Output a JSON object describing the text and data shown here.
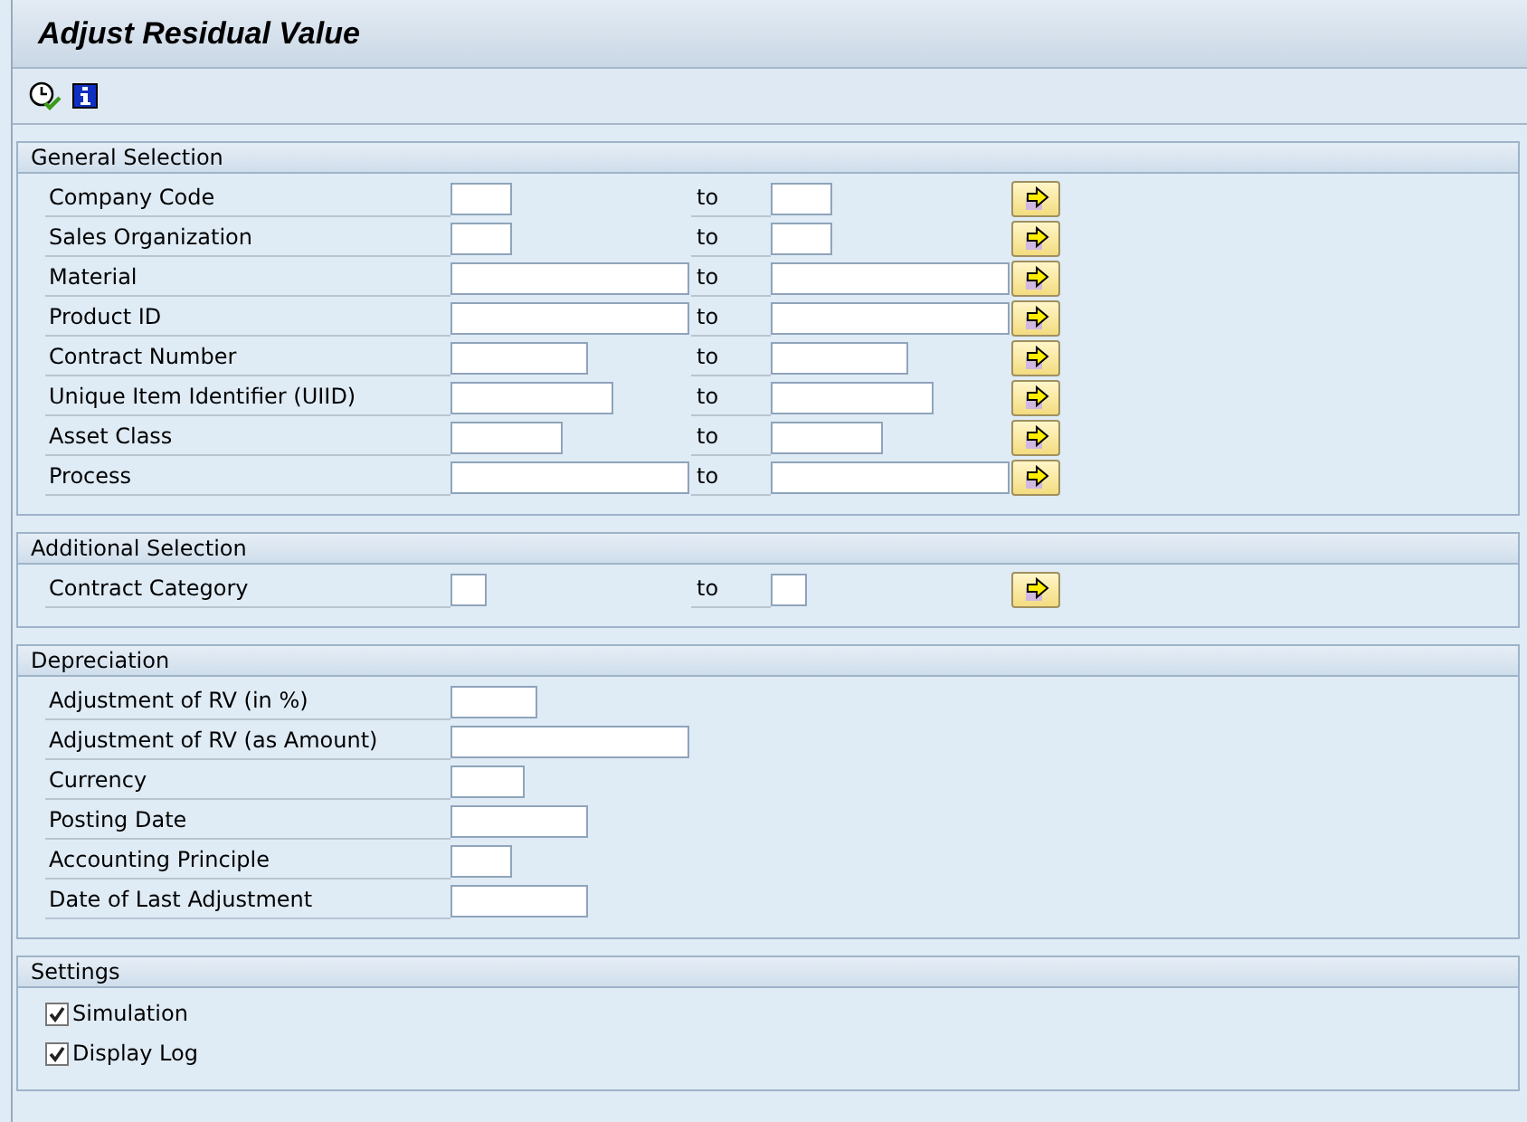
{
  "window": {
    "title": "Adjust Residual Value"
  },
  "toolbar": [
    {
      "kind": "execute-clock"
    },
    {
      "kind": "info"
    }
  ],
  "sections": [
    {
      "title": "General Selection",
      "rows": [
        {
          "kind": "range",
          "label": "Company Code",
          "to_label": "to"
        },
        {
          "kind": "range",
          "label": "Sales Organization",
          "to_label": "to"
        },
        {
          "kind": "range",
          "label": "Material",
          "to_label": "to"
        },
        {
          "kind": "range",
          "label": "Product ID",
          "to_label": "to"
        },
        {
          "kind": "range",
          "label": "Contract Number",
          "to_label": "to"
        },
        {
          "kind": "range",
          "label": "Unique Item Identifier (UIID)",
          "to_label": "to"
        },
        {
          "kind": "range",
          "label": "Asset Class",
          "to_label": "to"
        },
        {
          "kind": "range",
          "label": "Process",
          "to_label": "to"
        }
      ]
    },
    {
      "title": "Additional Selection",
      "rows": [
        {
          "kind": "range",
          "label": "Contract Category",
          "to_label": "to"
        }
      ]
    },
    {
      "title": "Depreciation",
      "rows": [
        {
          "kind": "single",
          "label": "Adjustment of RV (in %)"
        },
        {
          "kind": "single",
          "label": "Adjustment of RV (as Amount)"
        },
        {
          "kind": "single",
          "label": "Currency"
        },
        {
          "kind": "single",
          "label": "Posting Date"
        },
        {
          "kind": "single",
          "label": "Accounting Principle"
        },
        {
          "kind": "single",
          "label": "Date of Last Adjustment"
        }
      ]
    },
    {
      "title": "Settings",
      "rows": [
        {
          "kind": "checkbox",
          "label": "Simulation",
          "checked": true
        },
        {
          "kind": "checkbox",
          "label": "Display Log",
          "checked": true
        }
      ]
    }
  ]
}
